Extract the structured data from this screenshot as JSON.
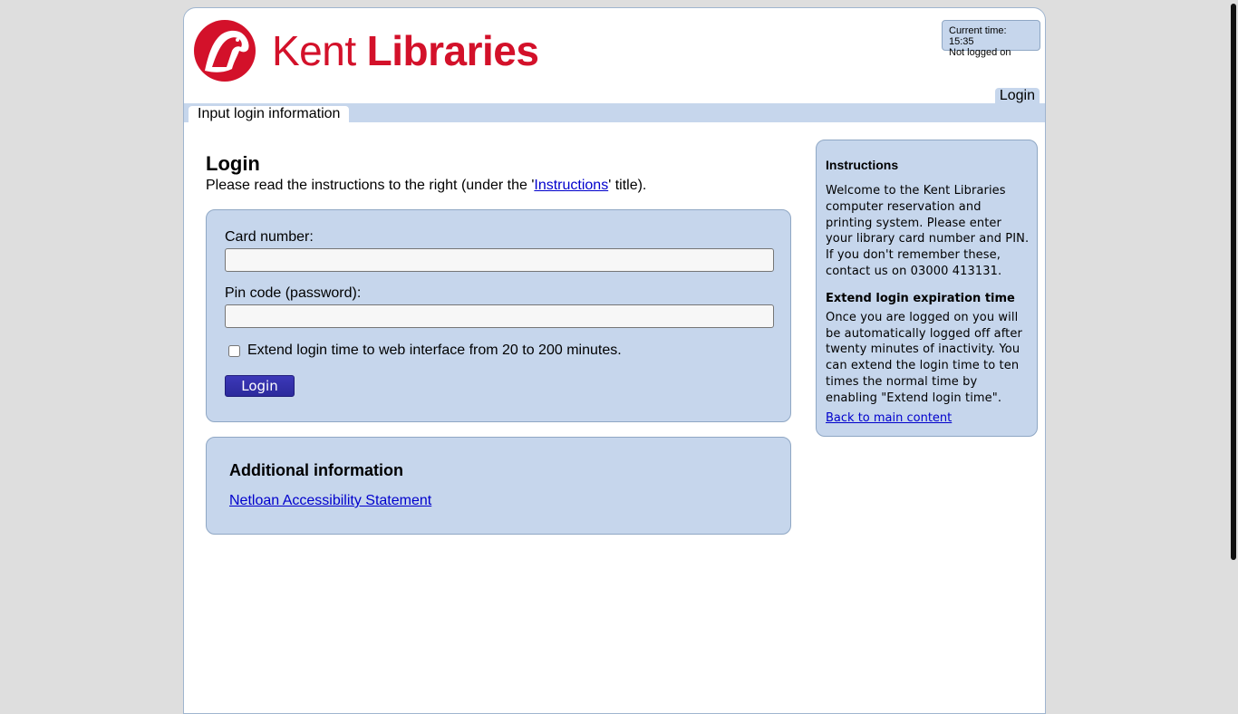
{
  "header": {
    "logo_text_light": "Kent",
    "logo_text_bold": "Libraries",
    "current_time": "Current time: 15:35",
    "login_status": "Not logged on",
    "login_tab": "Login",
    "tab_active": "Input login information",
    "brand_color": "#d3112a"
  },
  "main": {
    "title": "Login",
    "intro_before": "Please read the instructions to the right (under the '",
    "intro_link": "Instructions",
    "intro_after": "' title).",
    "form": {
      "card_label": "Card number:",
      "card_value": "",
      "pin_label": "Pin code (password):",
      "pin_value": "",
      "extend_label": "Extend login time to web interface from 20 to 200 minutes.",
      "extend_checked": false,
      "login_button": "Login"
    },
    "additional": {
      "title": "Additional information",
      "link": "Netloan Accessibility Statement"
    }
  },
  "sidebar": {
    "title": "Instructions",
    "welcome": "Welcome to the Kent Libraries computer reservation and printing system. Please enter your library card number and PIN. If you don't remember these, contact us on 03000 413131.",
    "extend_title": "Extend login expiration time",
    "extend_text": "Once you are logged on you will be automatically logged off after twenty minutes of inactivity. You can extend the login time to ten times the normal time by enabling \"Extend login time\".",
    "back_link": "Back to main content"
  },
  "colors": {
    "panel": "#c6d6ec",
    "panel_border": "#8fa7c4",
    "button": "#2c2a9c",
    "link": "#0000cc"
  }
}
